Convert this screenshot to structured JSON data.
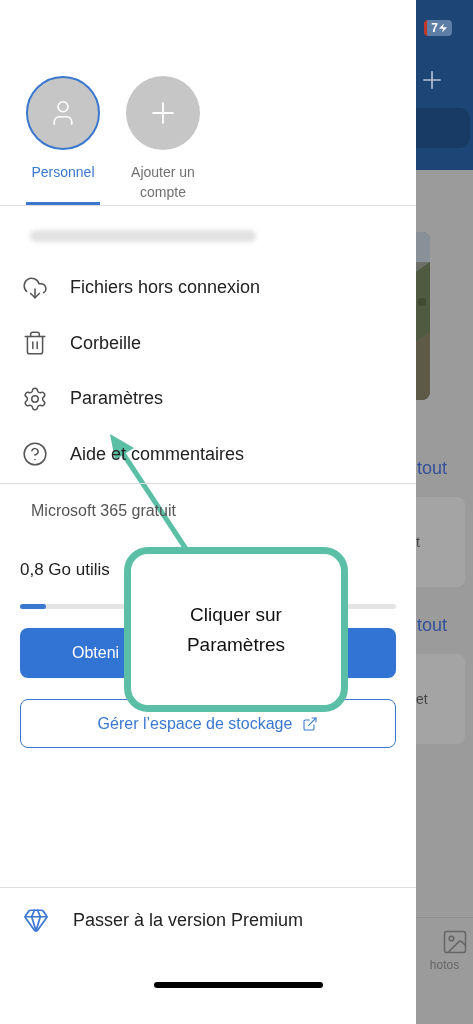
{
  "accounts": [
    {
      "label": "Personnel",
      "kind": "account",
      "selected": true
    },
    {
      "label": "Ajouter un compte",
      "kind": "add",
      "selected": false
    }
  ],
  "menu": [
    {
      "label": "Fichiers hors connexion",
      "kind": "cloud"
    },
    {
      "label": "Corbeille",
      "kind": "trash"
    },
    {
      "label": "Paramètres",
      "kind": "settings"
    },
    {
      "label": "Aide et commentaires",
      "kind": "help"
    }
  ],
  "plan": {
    "title": "Microsoft 365 gratuit",
    "usage": "0,8 Go utilis",
    "level": 0.07,
    "primary_button": "Obteni",
    "secondary_button": "Gérer l’espace de stockage"
  },
  "premium": {
    "label": "Passer à la version Premium"
  },
  "background": {
    "battery": "7",
    "links": [
      "tout",
      "tout"
    ],
    "card_texts": [
      "t",
      "et"
    ],
    "tab_label": "hotos"
  },
  "annotation": {
    "text": "Cliquer sur Paramètres"
  }
}
